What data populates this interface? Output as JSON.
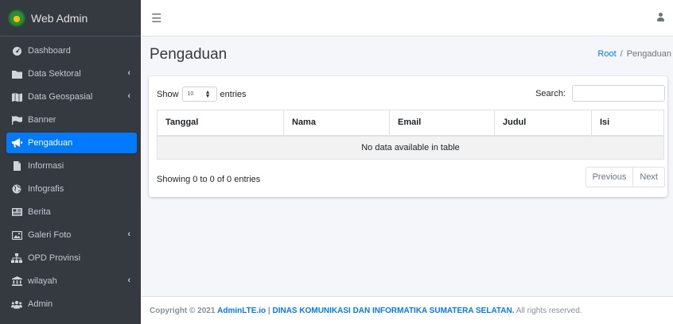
{
  "brand": {
    "title": "Web Admin"
  },
  "sidebar": {
    "items": [
      {
        "label": "Dashboard",
        "icon": "tachometer-icon",
        "active": false,
        "has_children": false
      },
      {
        "label": "Data Sektoral",
        "icon": "folder-icon",
        "active": false,
        "has_children": true
      },
      {
        "label": "Data Geospasial",
        "icon": "map-icon",
        "active": false,
        "has_children": true
      },
      {
        "label": "Banner",
        "icon": "flag-icon",
        "active": false,
        "has_children": false
      },
      {
        "label": "Pengaduan",
        "icon": "bullhorn-icon",
        "active": true,
        "has_children": false
      },
      {
        "label": "Informasi",
        "icon": "file-icon",
        "active": false,
        "has_children": false
      },
      {
        "label": "Infografis",
        "icon": "globe-icon",
        "active": false,
        "has_children": false
      },
      {
        "label": "Berita",
        "icon": "newspaper-icon",
        "active": false,
        "has_children": false
      },
      {
        "label": "Galeri Foto",
        "icon": "image-icon",
        "active": false,
        "has_children": true
      },
      {
        "label": "OPD Provinsi",
        "icon": "sitemap-icon",
        "active": false,
        "has_children": false
      },
      {
        "label": "wilayah",
        "icon": "landmark-icon",
        "active": false,
        "has_children": true
      },
      {
        "label": "Admin",
        "icon": "users-icon",
        "active": false,
        "has_children": false
      }
    ],
    "chevron": "‹"
  },
  "topbar": {
    "menu_icon": "☰"
  },
  "content": {
    "title": "Pengaduan",
    "breadcrumb": {
      "root": "Root",
      "separator": "/",
      "current": "Pengaduan"
    }
  },
  "table": {
    "length_prefix": "Show",
    "length_value": "10",
    "length_suffix": "entries",
    "search_label": "Search:",
    "search_value": "",
    "columns": [
      "Tanggal",
      "Nama",
      "Email",
      "Judul",
      "Isi"
    ],
    "empty_text": "No data available in table",
    "info_text": "Showing 0 to 0 of 0 entries",
    "previous_label": "Previous",
    "next_label": "Next"
  },
  "footer": {
    "copyright": "Copyright © 2021",
    "link1": "AdminLTE.io",
    "divider": "|",
    "link2": "DINAS KOMUNIKASI DAN INFORMATIKA SUMATERA SELATAN.",
    "suffix": "All rights reserved."
  },
  "colors": {
    "sidebar_bg": "#343a40",
    "active_item": "#007bff",
    "link": "#007bff",
    "content_bg": "#f4f6f9"
  }
}
